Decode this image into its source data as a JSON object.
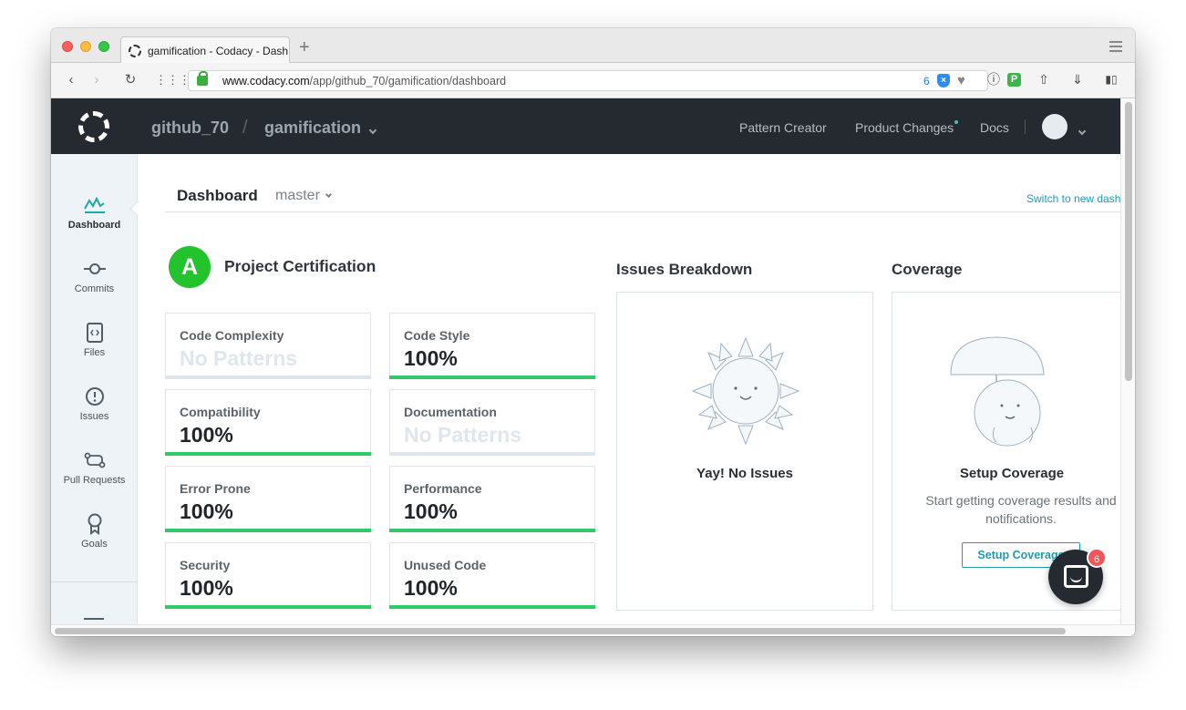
{
  "browser": {
    "tab_title": "gamification - Codacy - Dash",
    "url_host": "www.codacy.com",
    "url_path": "/app/github_70/gamification/dashboard",
    "extension_count": "6"
  },
  "header": {
    "org": "github_70",
    "separator": "/",
    "repo": "gamification",
    "nav": [
      "Pattern Creator",
      "Product Changes",
      "Docs"
    ]
  },
  "sidebar": {
    "items": [
      {
        "label": "Dashboard",
        "icon": "dashboard-icon"
      },
      {
        "label": "Commits",
        "icon": "commit-icon"
      },
      {
        "label": "Files",
        "icon": "file-code-icon"
      },
      {
        "label": "Issues",
        "icon": "alert-icon"
      },
      {
        "label": "Pull Requests",
        "icon": "pull-request-icon"
      },
      {
        "label": "Goals",
        "icon": "goal-icon"
      }
    ]
  },
  "dashboard": {
    "title": "Dashboard",
    "branch": "master",
    "switch_link": "Switch to new dash"
  },
  "certification": {
    "grade": "A",
    "title": "Project Certification",
    "cards": [
      {
        "label": "Code Complexity",
        "value": "No Patterns",
        "status": "none"
      },
      {
        "label": "Code Style",
        "value": "100%",
        "status": "ok"
      },
      {
        "label": "Compatibility",
        "value": "100%",
        "status": "ok"
      },
      {
        "label": "Documentation",
        "value": "No Patterns",
        "status": "none"
      },
      {
        "label": "Error Prone",
        "value": "100%",
        "status": "ok"
      },
      {
        "label": "Performance",
        "value": "100%",
        "status": "ok"
      },
      {
        "label": "Security",
        "value": "100%",
        "status": "ok"
      },
      {
        "label": "Unused Code",
        "value": "100%",
        "status": "ok"
      }
    ]
  },
  "issues": {
    "title": "Issues Breakdown",
    "caption": "Yay! No Issues"
  },
  "coverage": {
    "title": "Coverage",
    "caption": "Setup Coverage",
    "text": "Start getting coverage results and notifications.",
    "button": "Setup Coverage"
  },
  "chat": {
    "badge": "6"
  },
  "colors": {
    "accent": "#1e9bb4",
    "grade": "#22c32d",
    "bar_ok": "#2ecb68",
    "header": "#242a2f"
  }
}
